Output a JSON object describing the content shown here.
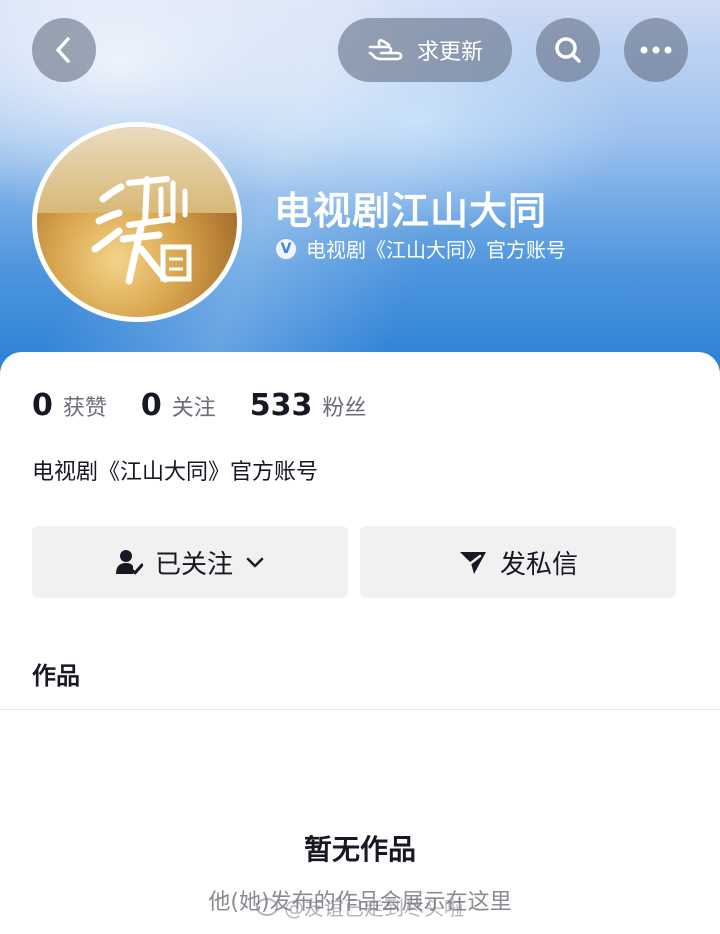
{
  "top_bar": {
    "update_label": "求更新"
  },
  "profile": {
    "name": "电视剧江山大同",
    "verify_text": "电视剧《江山大同》官方账号",
    "verify_badge": "V",
    "avatar_text": "江山大同"
  },
  "stats": [
    {
      "value": "0",
      "label": "获赞"
    },
    {
      "value": "0",
      "label": "关注"
    },
    {
      "value": "533",
      "label": "粉丝"
    }
  ],
  "bio": "电视剧《江山大同》官方账号",
  "actions": {
    "follow_label": "已关注",
    "dm_label": "发私信"
  },
  "tabs": {
    "works": "作品"
  },
  "empty_state": {
    "title": "暂无作品",
    "subtitle": "他(她)发布的作品会展示在这里"
  },
  "watermark": "@友谊已走到尽头啦",
  "colors": {
    "header_blue": "#2a7fd6",
    "button_gray": "#f1f1f2",
    "text_dark": "#161823",
    "text_gray": "#6b6d76"
  },
  "icons": [
    "back-arrow-icon",
    "hand-point-icon",
    "search-icon",
    "more-dots-icon",
    "verified-icon",
    "user-check-icon",
    "chevron-down-icon",
    "send-icon",
    "weibo-icon"
  ]
}
